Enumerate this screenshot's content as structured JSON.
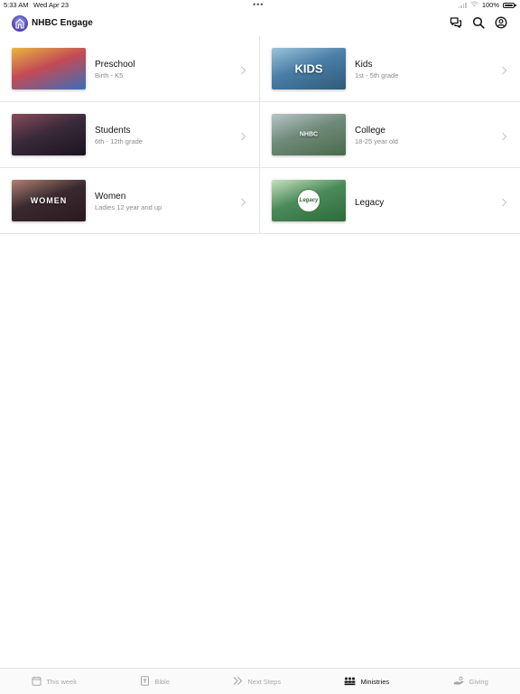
{
  "status_bar": {
    "time": "5:33 AM",
    "date": "Wed Apr 23",
    "dots": "•••",
    "battery": "100%"
  },
  "header": {
    "title": "NHBC Engage",
    "icons": [
      "chat-icon",
      "search-icon",
      "account-icon"
    ]
  },
  "ministries": [
    {
      "title": "Preschool",
      "subtitle": "Birth - K5",
      "thumb_text": "",
      "thumb_colors": [
        "#c44a55",
        "#e8b640",
        "#3a6fb8"
      ]
    },
    {
      "title": "Kids",
      "subtitle": "1st - 5th grade",
      "thumb_text": "KIDS",
      "thumb_colors": [
        "#4a7ea8",
        "#9bc3d8",
        "#2f5a78"
      ]
    },
    {
      "title": "Students",
      "subtitle": "6th - 12th grade",
      "thumb_text": "",
      "thumb_colors": [
        "#3a2a3a",
        "#8a4a5a",
        "#1a1420"
      ]
    },
    {
      "title": "College",
      "subtitle": "18-25 year old",
      "thumb_text": "NHBC",
      "thumb_colors": [
        "#6f8a7a",
        "#b8c6c8",
        "#4a6a4a"
      ]
    },
    {
      "title": "Women",
      "subtitle": "Ladies 12 year and up",
      "thumb_text": "WOMEN",
      "thumb_colors": [
        "#3a2a30",
        "#b08070",
        "#2a1a20"
      ]
    },
    {
      "title": "Legacy",
      "subtitle": "",
      "thumb_text": "Legacy",
      "thumb_colors": [
        "#4a8a5a",
        "#c8e0c0",
        "#2f6a3a"
      ]
    }
  ],
  "tabs": [
    {
      "label": "This week",
      "icon": "calendar-icon",
      "active": false
    },
    {
      "label": "Bible",
      "icon": "bible-icon",
      "active": false
    },
    {
      "label": "Next Steps",
      "icon": "chevrons-icon",
      "active": false
    },
    {
      "label": "Ministries",
      "icon": "people-icon",
      "active": true
    },
    {
      "label": "Giving",
      "icon": "giving-icon",
      "active": false
    }
  ],
  "colors": {
    "divider": "#e6e6e6",
    "inactive_tab": "#a8a8a8",
    "subtitle": "#8a8a8a"
  }
}
